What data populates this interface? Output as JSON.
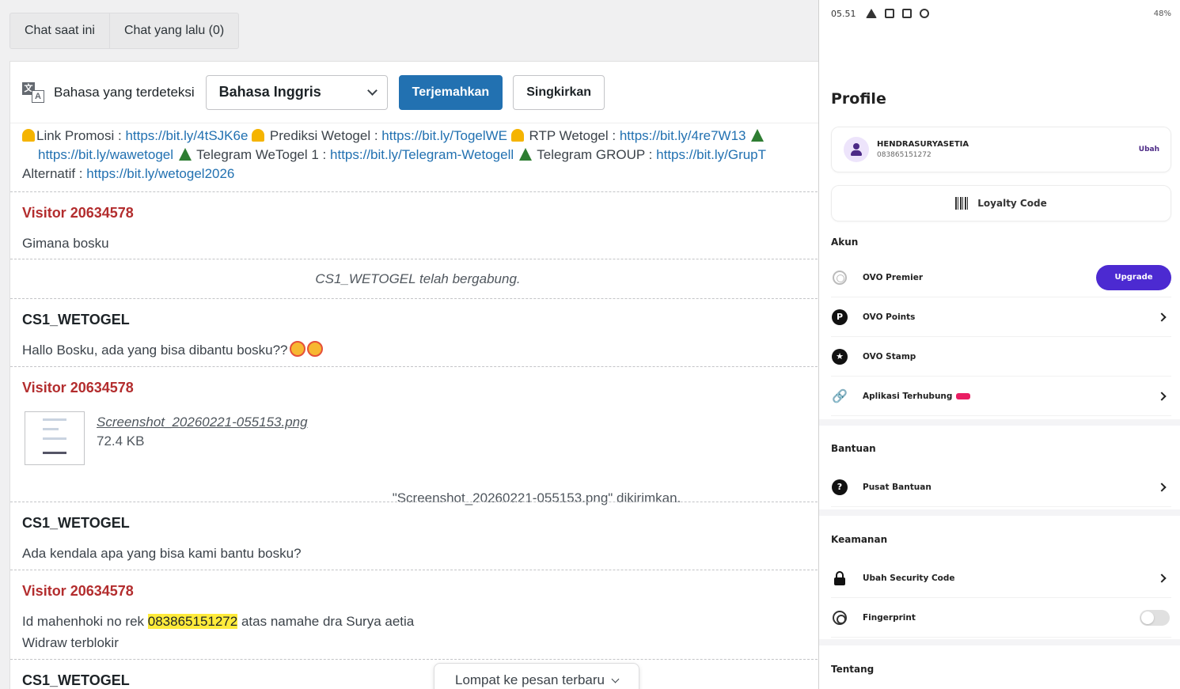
{
  "tabs": {
    "current": "Chat saat ini",
    "past": "Chat yang lalu (0)"
  },
  "translate": {
    "detected_label": "Bahasa yang terdeteksi",
    "selected_language": "Bahasa Inggris",
    "translate_btn": "Terjemahkan",
    "dismiss_btn": "Singkirkan"
  },
  "promo": {
    "l1_a": "Link Promosi : ",
    "l1_link1": "https://bit.ly/4tSJK6e",
    "l1_b": " Prediksi Wetogel : ",
    "l1_link2": "https://bit.ly/TogelWE",
    "l1_c": " RTP Wetogel : ",
    "l1_link3": "https://bit.ly/4re7W13",
    "l2_link1": "https://bit.ly/wawetogel",
    "l2_a": " Telegram WeTogel 1 : ",
    "l2_link2": "https://bit.ly/Telegram-Wetogell",
    "l2_b": " Telegram GROUP : ",
    "l2_link3": "https://bit.ly/GrupT",
    "l3_a": "Alternatif : ",
    "l3_link": "https://bit.ly/wetogel2026"
  },
  "messages": {
    "m1_sender": "Visitor 20634578",
    "m1_text": "Gimana bosku",
    "sys1": "CS1_WETOGEL telah bergabung.",
    "m2_sender": "CS1_WETOGEL",
    "m2_text": "Hallo Bosku, ada yang bisa dibantu bosku??",
    "m3_sender": "Visitor 20634578",
    "m3_file_name": "Screenshot_20260221-055153.png",
    "m3_file_size": "72.4 KB",
    "m3_sent_note": "\"Screenshot_20260221-055153.png\" dikirimkan.",
    "m4_sender": "CS1_WETOGEL",
    "m4_text": "Ada kendala apa yang bisa kami bantu bosku?",
    "m5_sender": "Visitor 20634578",
    "m5_text_a": "Id mahenhoki no rek ",
    "m5_highlight": "083865151272",
    "m5_text_b": " atas namahe dra Surya aetia",
    "m5_text_line2": "Widraw terblokir",
    "m6_sender": "CS1_WETOGEL"
  },
  "jump_btn": "Lompat ke pesan terbaru",
  "phone": {
    "status_time": "05.51",
    "status_right": "48%",
    "title": "Profile",
    "user_name": "HENDRASURYASETIA",
    "user_phone": "083865151272",
    "edit": "Ubah",
    "loyalty": "Loyalty Code",
    "sections": {
      "akun": "Akun",
      "bantuan": "Bantuan",
      "keamanan": "Keamanan",
      "tentang": "Tentang"
    },
    "rows": {
      "premier": "OVO Premier",
      "upgrade": "Upgrade",
      "points": "OVO Points",
      "stamp": "OVO Stamp",
      "apps": "Aplikasi Terhubung",
      "help": "Pusat Bantuan",
      "security": "Ubah Security Code",
      "fingerprint": "Fingerprint"
    },
    "accent": "#4c2ad1"
  }
}
